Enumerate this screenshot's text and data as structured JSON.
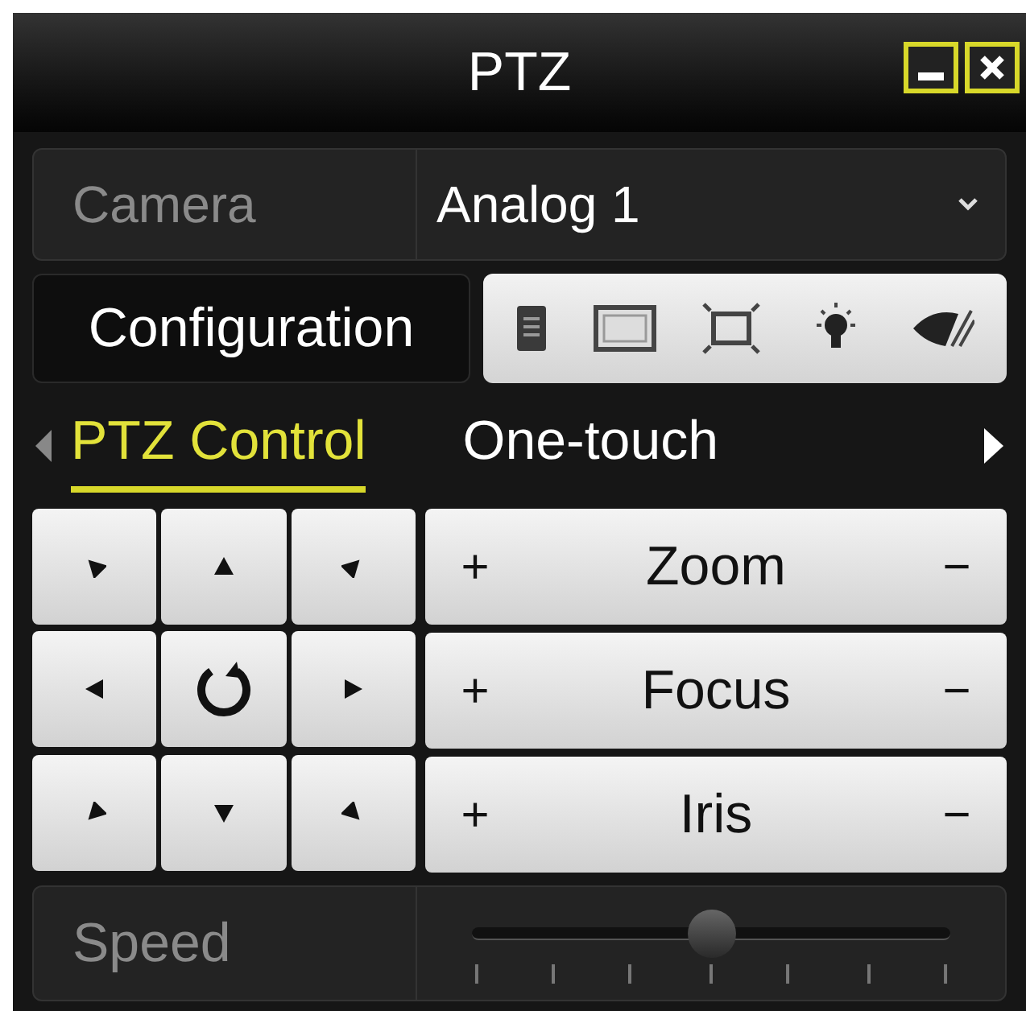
{
  "window": {
    "title": "PTZ"
  },
  "camera": {
    "label": "Camera",
    "value": "Analog 1"
  },
  "configuration": {
    "label": "Configuration"
  },
  "tabs": [
    {
      "label": "PTZ Control",
      "selected": true
    },
    {
      "label": "One-touch",
      "selected": false
    }
  ],
  "lens_controls": [
    {
      "plus": "+",
      "label": "Zoom",
      "minus": "−"
    },
    {
      "plus": "+",
      "label": "Focus",
      "minus": "−"
    },
    {
      "plus": "+",
      "label": "Iris",
      "minus": "−"
    }
  ],
  "speed": {
    "label": "Speed",
    "level": 0.5
  }
}
